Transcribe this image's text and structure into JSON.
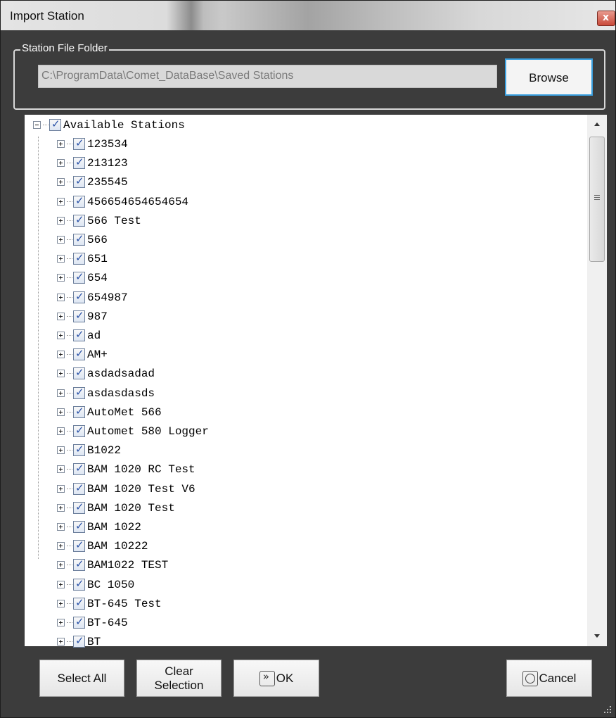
{
  "window": {
    "title": "Import Station",
    "close_label": "x"
  },
  "folder_group": {
    "legend": "Station File Folder",
    "path_value": "C:\\ProgramData\\Comet_DataBase\\Saved Stations",
    "browse_label": "Browse"
  },
  "tree": {
    "root_label": "Available Stations",
    "root_checked": true,
    "items": [
      "123534",
      "213123",
      "235545",
      "456654654654654",
      "566 Test",
      "566",
      "651",
      "654",
      "654987",
      "987",
      "ad",
      "AM+",
      "asdadsadad",
      "asdasdasds",
      "AutoMet 566",
      "Automet 580 Logger",
      "B1022",
      "BAM 1020 RC Test",
      "BAM 1020 Test V6",
      "BAM 1020 Test",
      "BAM 1022",
      "BAM 10222",
      "BAM1022 TEST",
      "BC 1050",
      "BT-645 Test",
      "BT-645",
      "BT"
    ]
  },
  "buttons": {
    "select_all": "Select All",
    "clear_line1": "Clear",
    "clear_line2": "Selection",
    "ok": "OK",
    "cancel": "Cancel"
  }
}
